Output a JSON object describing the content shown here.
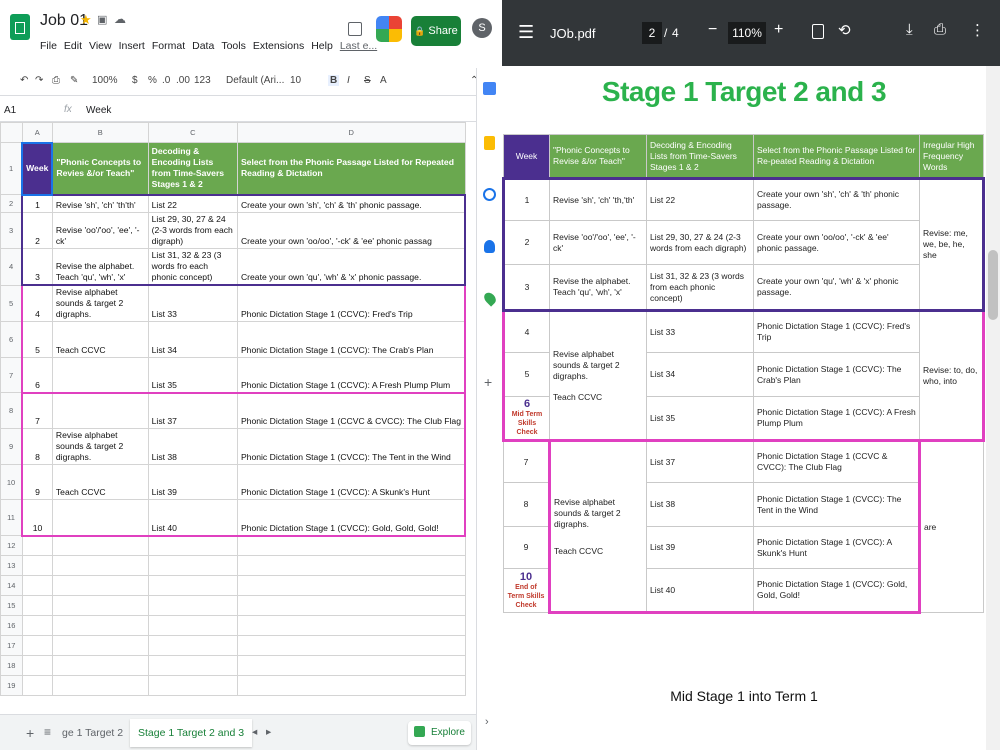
{
  "sheets": {
    "doc_title": "Job 01",
    "menus": [
      "File",
      "Edit",
      "View",
      "Insert",
      "Format",
      "Data",
      "Tools",
      "Extensions",
      "Help",
      "Last e..."
    ],
    "share_label": "Share",
    "avatar_letter": "S",
    "toolbar": {
      "zoom": "100%",
      "currency": "$",
      "percent": "%",
      "dec1": ".0",
      "dec2": ".00",
      "fmt": "123",
      "font": "Default (Ari...",
      "size": "10",
      "bold": "B",
      "italic": "I",
      "strike": "S",
      "textcolor": "A"
    },
    "name_box": "A1",
    "fx": "fx",
    "formula_value": "Week",
    "col_headers": [
      "A",
      "B",
      "C",
      "D"
    ],
    "header_row": {
      "week": "Week",
      "b": "\"Phonic Concepts to Revies &/or Teach\"",
      "c": "Decoding & Encoding Lists from Time-Savers Stages 1 & 2",
      "d": "Select from the Phonic Passage Listed for Repeated Reading & Dictation"
    },
    "rows": [
      {
        "n": "2",
        "a": "1",
        "b": "Revise 'sh', 'ch' 'th'th'",
        "c": "List 22",
        "d": "Create your own 'sh', 'ch' & 'th' phonic passage."
      },
      {
        "n": "3",
        "a": "2",
        "b": "Revise 'oo'/'oo', 'ee', '-ck'",
        "c": "List 29, 30, 27 & 24 (2-3 words from each digraph)",
        "d": "Create your own 'oo/oo', '-ck' & 'ee' phonic passag"
      },
      {
        "n": "4",
        "a": "3",
        "b": "Revise the alphabet. Teach 'qu', 'wh', 'x'",
        "c": "List 31, 32 & 23 (3 words fro each phonic concept)",
        "d": "Create your own 'qu', 'wh' & 'x' phonic passage."
      },
      {
        "n": "5",
        "a": "4",
        "b": "Revise alphabet sounds & target 2 digraphs.",
        "c": "List 33",
        "d": "Phonic Dictation Stage 1 (CCVC): Fred's Trip"
      },
      {
        "n": "6",
        "a": "5",
        "b": "Teach CCVC",
        "c": "List 34",
        "d": "Phonic Dictation Stage 1 (CCVC): The Crab's Plan"
      },
      {
        "n": "7",
        "a": "6",
        "b": "",
        "c": "List 35",
        "d": "Phonic Dictation Stage 1 (CCVC): A Fresh Plump Plum"
      },
      {
        "n": "8",
        "a": "7",
        "b": "",
        "c": "List 37",
        "d": "Phonic Dictation Stage 1 (CCVC & CVCC): The Club Flag"
      },
      {
        "n": "9",
        "a": "8",
        "b": "Revise alphabet sounds & target 2 digraphs.",
        "c": "List 38",
        "d": "Phonic Dictation Stage 1 (CVCC): The Tent in the Wind"
      },
      {
        "n": "10",
        "a": "9",
        "b": "Teach CCVC",
        "c": "List 39",
        "d": "Phonic Dictation Stage 1 (CVCC): A Skunk's Hunt"
      },
      {
        "n": "11",
        "a": "10",
        "b": "",
        "c": "List 40",
        "d": "Phonic Dictation Stage 1 (CVCC): Gold, Gold, Gold!"
      }
    ],
    "empty_rows": [
      "12",
      "13",
      "14",
      "15",
      "16",
      "17",
      "18",
      "19"
    ],
    "tabs": {
      "prev": "ge 1 Target 2",
      "active": "Stage 1 Target 2 and 3",
      "explore": "Explore"
    }
  },
  "pdf": {
    "filename": "JOb.pdf",
    "page_current": "2",
    "page_sep": "/",
    "page_total": "4",
    "zoom": "110%",
    "title": "Stage 1 Target 2 and 3",
    "headers": {
      "week": "Week",
      "b": "\"Phonic Concepts to Revise &/or Teach\"",
      "c": "Decoding & Encoding Lists from Time-Savers Stages 1 & 2",
      "d": "Select from the Phonic Passage Listed for Re-peated Reading & Dictation",
      "e": "Irregular High Frequency Words"
    },
    "rows": [
      {
        "a": "1",
        "b": "Revise 'sh', 'ch' 'th,'th'",
        "c": "List 22",
        "d": "Create your own 'sh', 'ch' & 'th' phonic passage."
      },
      {
        "a": "2",
        "b": "Revise 'oo'/'oo', 'ee', '-ck'",
        "c": "List 29, 30, 27 & 24 (2-3 words from each digraph)",
        "d": "Create your own 'oo/oo', '-ck' & 'ee' phonic passage."
      },
      {
        "a": "3",
        "b": "Revise the alphabet. Teach 'qu', 'wh', 'x'",
        "c": "List 31, 32 & 23 (3 words from each phonic concept)",
        "d": "Create your own 'qu', 'wh' & 'x' phonic passage."
      },
      {
        "a": "4",
        "b": "Revise alphabet sounds & target 2 digraphs.",
        "c": "List 33",
        "d": "Phonic Dictation Stage 1 (CCVC): Fred's Trip"
      },
      {
        "a": "5",
        "b": "Teach CCVC",
        "c": "List 34",
        "d": "Phonic Dictation Stage 1 (CCVC): The Crab's Plan"
      },
      {
        "a": "6",
        "a_note": "Mid Term Skills Check",
        "c": "List 35",
        "d": "Phonic Dictation Stage 1 (CCVC): A Fresh Plump Plum"
      },
      {
        "a": "7",
        "b": "Revise alphabet sounds & target 2 digraphs.",
        "c": "List 37",
        "d": "Phonic Dictation Stage 1 (CCVC & CVCC): The Club Flag"
      },
      {
        "a": "8",
        "b": "Teach CCVC",
        "c": "List 38",
        "d": "Phonic Dictation Stage 1 (CVCC): The Tent in the Wind"
      },
      {
        "a": "9",
        "c": "List 39",
        "d": "Phonic Dictation Stage 1 (CVCC): A Skunk's Hunt"
      },
      {
        "a": "10",
        "a_note": "End of Term Skills Check",
        "c": "List 40",
        "d": "Phonic Dictation Stage 1 (CVCC): Gold, Gold, Gold!"
      }
    ],
    "irregular": {
      "g1": "Revise: me, we, be, he, she",
      "g2": "Revise: to, do, who, into",
      "g3": "are"
    },
    "footer": "Mid Stage 1 into Term 1"
  },
  "colors": {
    "green": "#6aa84f",
    "purple": "#4b2f8f",
    "magenta": "#e040c0",
    "pdf_title": "#2bb24c",
    "pdf_toolbar": "#323639"
  }
}
